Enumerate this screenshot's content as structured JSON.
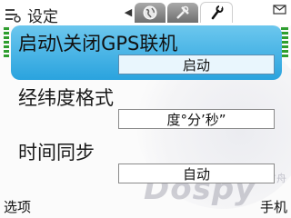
{
  "status_bar": {
    "title": "设定",
    "tabs": [
      {
        "name": "globe-icon",
        "active": false
      },
      {
        "name": "tools-icon",
        "active": false
      },
      {
        "name": "wrench-icon",
        "active": true
      }
    ],
    "mail_indicator": "mail-icon"
  },
  "settings": {
    "items": [
      {
        "label": "启动\\关闭GPS联机",
        "value": "启动"
      },
      {
        "label": "经纬度格式",
        "value": "度°分’秒”"
      },
      {
        "label": "时间同步",
        "value": "自动"
      }
    ]
  },
  "softkeys": {
    "left": "选项",
    "right": "手机"
  },
  "watermark": {
    "text": "Dospy",
    "sub": "诺亚方舟"
  },
  "colors": {
    "selection": "#2aa3de",
    "indicator": "#2f9e2f"
  }
}
